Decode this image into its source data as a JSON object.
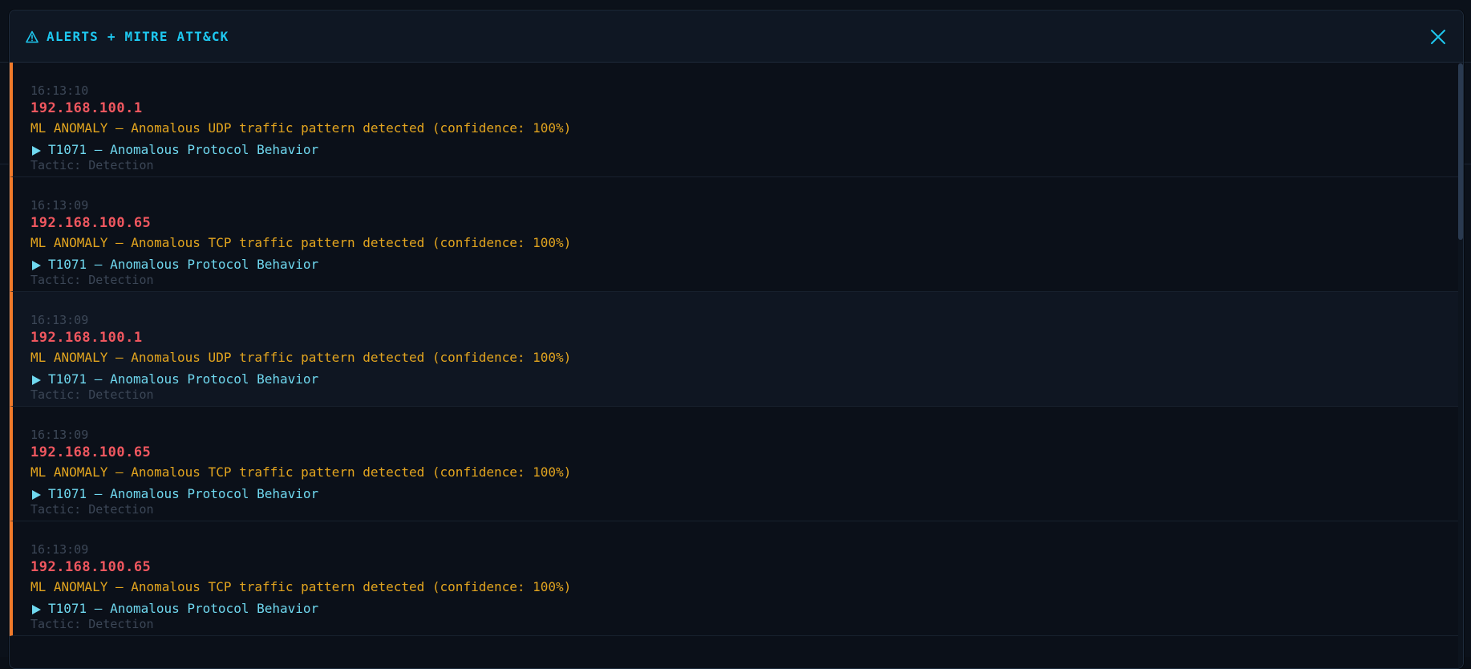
{
  "header": {
    "title": "ALERTS + MITRE ATT&CK",
    "accent_color": "#1ec8f0"
  },
  "alerts": [
    {
      "time": "16:13:10",
      "ip": "192.168.100.1",
      "message": "ML ANOMALY — Anomalous UDP traffic pattern detected (confidence: 100%)",
      "technique": "T1071 — Anomalous Protocol Behavior",
      "tactic": "Tactic: Detection"
    },
    {
      "time": "16:13:09",
      "ip": "192.168.100.65",
      "message": "ML ANOMALY — Anomalous TCP traffic pattern detected (confidence: 100%)",
      "technique": "T1071 — Anomalous Protocol Behavior",
      "tactic": "Tactic: Detection"
    },
    {
      "time": "16:13:09",
      "ip": "192.168.100.1",
      "message": "ML ANOMALY — Anomalous UDP traffic pattern detected (confidence: 100%)",
      "technique": "T1071 — Anomalous Protocol Behavior",
      "tactic": "Tactic: Detection"
    },
    {
      "time": "16:13:09",
      "ip": "192.168.100.65",
      "message": "ML ANOMALY — Anomalous TCP traffic pattern detected (confidence: 100%)",
      "technique": "T1071 — Anomalous Protocol Behavior",
      "tactic": "Tactic: Detection"
    },
    {
      "time": "16:13:09",
      "ip": "192.168.100.65",
      "message": "ML ANOMALY — Anomalous TCP traffic pattern detected (confidence: 100%)",
      "technique": "T1071 — Anomalous Protocol Behavior",
      "tactic": "Tactic: Detection"
    }
  ],
  "colors": {
    "severity_bar": "#f07a2a",
    "ip": "#f0575f",
    "message": "#e3a51f",
    "technique": "#6fd8ef",
    "muted": "#3c4757"
  },
  "icons": {
    "header": "warning-triangle-icon",
    "close": "close-icon",
    "technique": "play-triangle-icon"
  }
}
